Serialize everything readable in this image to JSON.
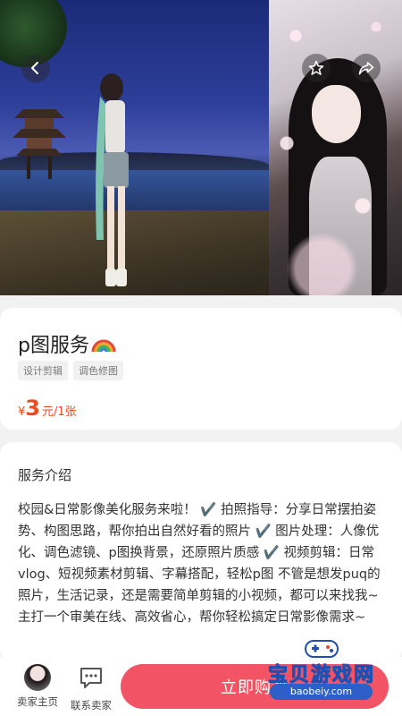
{
  "header": {
    "back_icon": "chevron-left-icon",
    "favorite_icon": "star-icon",
    "share_icon": "share-icon"
  },
  "product": {
    "title": "p图服务",
    "title_emoji_icon": "rainbow-icon",
    "tags": [
      "设计剪辑",
      "调色修图"
    ],
    "price_currency": "¥",
    "price_amount": "3",
    "price_unit": "元/1张"
  },
  "description": {
    "heading": "服务介绍",
    "body": "校园&日常影像美化服务来啦！ ✔️ 拍照指导：分享日常摆拍姿势、构图思路，帮你拍出自然好看的照片 ✔️ 图片处理：人像优化、调色滤镜、p图换背景，还原照片质感 ✔️ 视频剪辑：日常vlog、短视频素材剪辑、字幕搭配，轻松p图 不管是想发puq的照片，生活记录，还是需要简单剪辑的小视频，都可以来找我~ 主打一个审美在线、高效省心，帮你轻松搞定日常影像需求~"
  },
  "bottom_bar": {
    "shop_label": "卖家主页",
    "contact_label": "联系卖家",
    "buy_label": "立即购买"
  },
  "watermark": {
    "text": "宝贝游戏网",
    "url": "baobeiy.com"
  },
  "colors": {
    "price": "#f24a1e",
    "buy_button": "#f25465"
  }
}
